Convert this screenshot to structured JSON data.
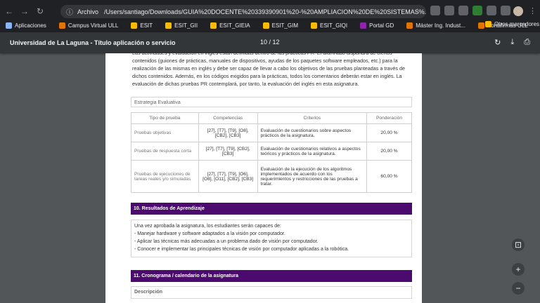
{
  "browser": {
    "scheme": "Archivo",
    "url": "/Users/santiago/Downloads/GUIA%20DOCENTE%20339390901%20-%20AMPLIACION%20DE%20SISTEMAS%...",
    "bookmarks": [
      "Aplicaciones",
      "Campus Virtual ULL",
      "ESIT",
      "ESIT_GII",
      "ESIT_GIEIA",
      "ESIT_GIM",
      "ESIT_GIQI",
      "Portal GD",
      "Máster Ing. Indust...",
      "Portafirmas ULL"
    ],
    "other_bookmarks": "Otros marcadores"
  },
  "pdf": {
    "title": "Universidad de La Laguna - Título aplicación o servicio",
    "page_indicator": "10 / 12"
  },
  "doc": {
    "intro_paragraph": "Las actividades y evaluación en inglés están definidas dentro de las prácticas PR. El alumnado dispondrá de ciertos contenidos (guiones de prácticas, manuales de dispositivos, ayudas de los paquetes software empleados, etc.) para la realización de las mismas en inglés y debe ser capaz de llevar a cabo los objetivos de las pruebas planteadas a través de dichos contenidos. Además, en los códigos exigidos para la prácticas, todos los comentarios deberán estar en inglés. La evaluación de dichas pruebas PR contemplará, por tanto, la evaluación del inglés en esta asignatura.",
    "eval_strategy_label": "Estrategia Evaluativa",
    "table": {
      "headers": [
        "Tipo de prueba",
        "Competencias",
        "Criterios",
        "Ponderación"
      ],
      "rows": [
        {
          "tipo": "Pruebas objetivas",
          "comp": "[27], [T7], [T9], [O8], [CB2], [CB3]",
          "crit": "Evaluación de cuestionarios sobre aspectos prácticos de la asignatura.",
          "pond": "20,00 %"
        },
        {
          "tipo": "Pruebas de respuesta corta",
          "comp": "[27], [T7], [T9], [CB2], [CB3]",
          "crit": "Evaluación de cuestionarios relativos a aspectos teóricos y prácticos de la asignatura.",
          "pond": "20,00 %"
        },
        {
          "tipo": "Pruebas de ejecuciones de tareas reales y/o simuladas",
          "comp": "[27], [T7], [T9], [O6], [O8], [O11], [CB2], [CB3]",
          "crit": "Evaluación de la ejecución de los algoritmos implementados de acuerdo con los requerimientos y restricciones de las pruebas a tratar.",
          "pond": "60,00 %"
        }
      ]
    },
    "section10_title": "10. Resultados de Aprendizaje",
    "results": [
      "Una vez aprobada la asignatura, los estudiantes serán capaces de:",
      "- Manejar hardware y software adaptados a la visión por computador.",
      "- Aplicar las técnicas más adecuadas a un problema dado de visión por computador.",
      "- Conocer e implementar las principales técnicas de visión por computador aplicadas a la robótica."
    ],
    "section11_title": "11. Cronograma / calendario de la asignatura",
    "description_label": "Descripción"
  },
  "icons": {
    "back": "←",
    "forward": "→",
    "reload": "↻",
    "info": "ⓘ",
    "star": "☆",
    "rotate": "↻",
    "download": "⤓",
    "print": "⎙",
    "fit": "⊡",
    "zoom_in": "+",
    "zoom_out": "−",
    "menu": "⋮"
  },
  "colors": {
    "section_header": "#4b0b6e",
    "chrome_bg": "#202124",
    "viewer_bg": "#525659"
  }
}
